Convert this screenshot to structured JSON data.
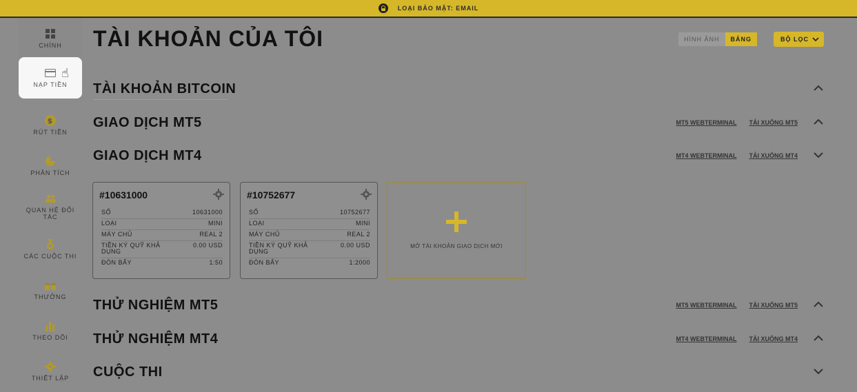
{
  "security_bar": {
    "text": "LOẠI BẢO MẬT: EMAIL"
  },
  "sidebar": {
    "items": [
      {
        "label": "CHÍNH",
        "icon": "dashboard-icon"
      },
      {
        "label": "NẠP TIỀN",
        "icon": "card-icon"
      },
      {
        "label": "RÚT TIỀN",
        "icon": "dollar-icon"
      },
      {
        "label": "PHÂN TÍCH",
        "icon": "pie-chart-icon"
      },
      {
        "label": "QUAN HỆ ĐỐI TÁC",
        "icon": "partners-icon"
      },
      {
        "label": "CÁC CUỘC THI",
        "icon": "medal-icon"
      },
      {
        "label": "THƯỞNG",
        "icon": "gift-icon"
      },
      {
        "label": "THEO DÕI",
        "icon": "bar-chart-icon"
      },
      {
        "label": "THIẾT LẬP",
        "icon": "gear-icon"
      }
    ]
  },
  "page_title": "TÀI KHOẢN CỦA TÔI",
  "view_toggle": {
    "image": "HÌNH ẢNH",
    "table": "BẢNG"
  },
  "filter_label": "BỘ LỌC",
  "sections": [
    {
      "title": "TÀI KHOẢN BITCOIN",
      "links": [],
      "expanded": true
    },
    {
      "title": "GIAO DỊCH MT5",
      "links": [
        "MT5 WEBTERMINAL",
        "TẢI XUỐNG MT5"
      ],
      "expanded": true
    },
    {
      "title": "GIAO DỊCH MT4",
      "links": [
        "MT4 WEBTERMINAL",
        "TẢI XUỐNG MT4"
      ],
      "expanded": false
    },
    {
      "title": "THỬ NGHIỆM MT5",
      "links": [
        "MT5 WEBTERMINAL",
        "TẢI XUỐNG MT5"
      ],
      "expanded": true
    },
    {
      "title": "THỬ NGHIỆM MT4",
      "links": [
        "MT4 WEBTERMINAL",
        "TẢI XUỐNG MT4"
      ],
      "expanded": true
    },
    {
      "title": "CUỘC THI",
      "links": [],
      "expanded": false
    }
  ],
  "accounts": [
    {
      "number": "#10631000",
      "rows": [
        {
          "k": "SỐ",
          "v": "10631000"
        },
        {
          "k": "LOẠI",
          "v": "MINI"
        },
        {
          "k": "MÁY CHỦ",
          "v": "REAL 2"
        },
        {
          "k": "TIỀN KÝ QUỸ KHẢ DỤNG",
          "v": "0.00 USD"
        },
        {
          "k": "ĐÒN BẨY",
          "v": "1:50"
        }
      ]
    },
    {
      "number": "#10752677",
      "rows": [
        {
          "k": "SỐ",
          "v": "10752677"
        },
        {
          "k": "LOẠI",
          "v": "MINI"
        },
        {
          "k": "MÁY CHỦ",
          "v": "REAL 2"
        },
        {
          "k": "TIỀN KÝ QUỸ KHẢ DỤNG",
          "v": "0.00 USD"
        },
        {
          "k": "ĐÒN BẨY",
          "v": "1:2000"
        }
      ]
    }
  ],
  "add_account_label": "MỞ TÀI KHOẢN GIAO DỊCH MỚI",
  "colors": {
    "accent": "#d6b729",
    "overlay": "#8c8c8c",
    "active_item": "#f7f7f7"
  }
}
